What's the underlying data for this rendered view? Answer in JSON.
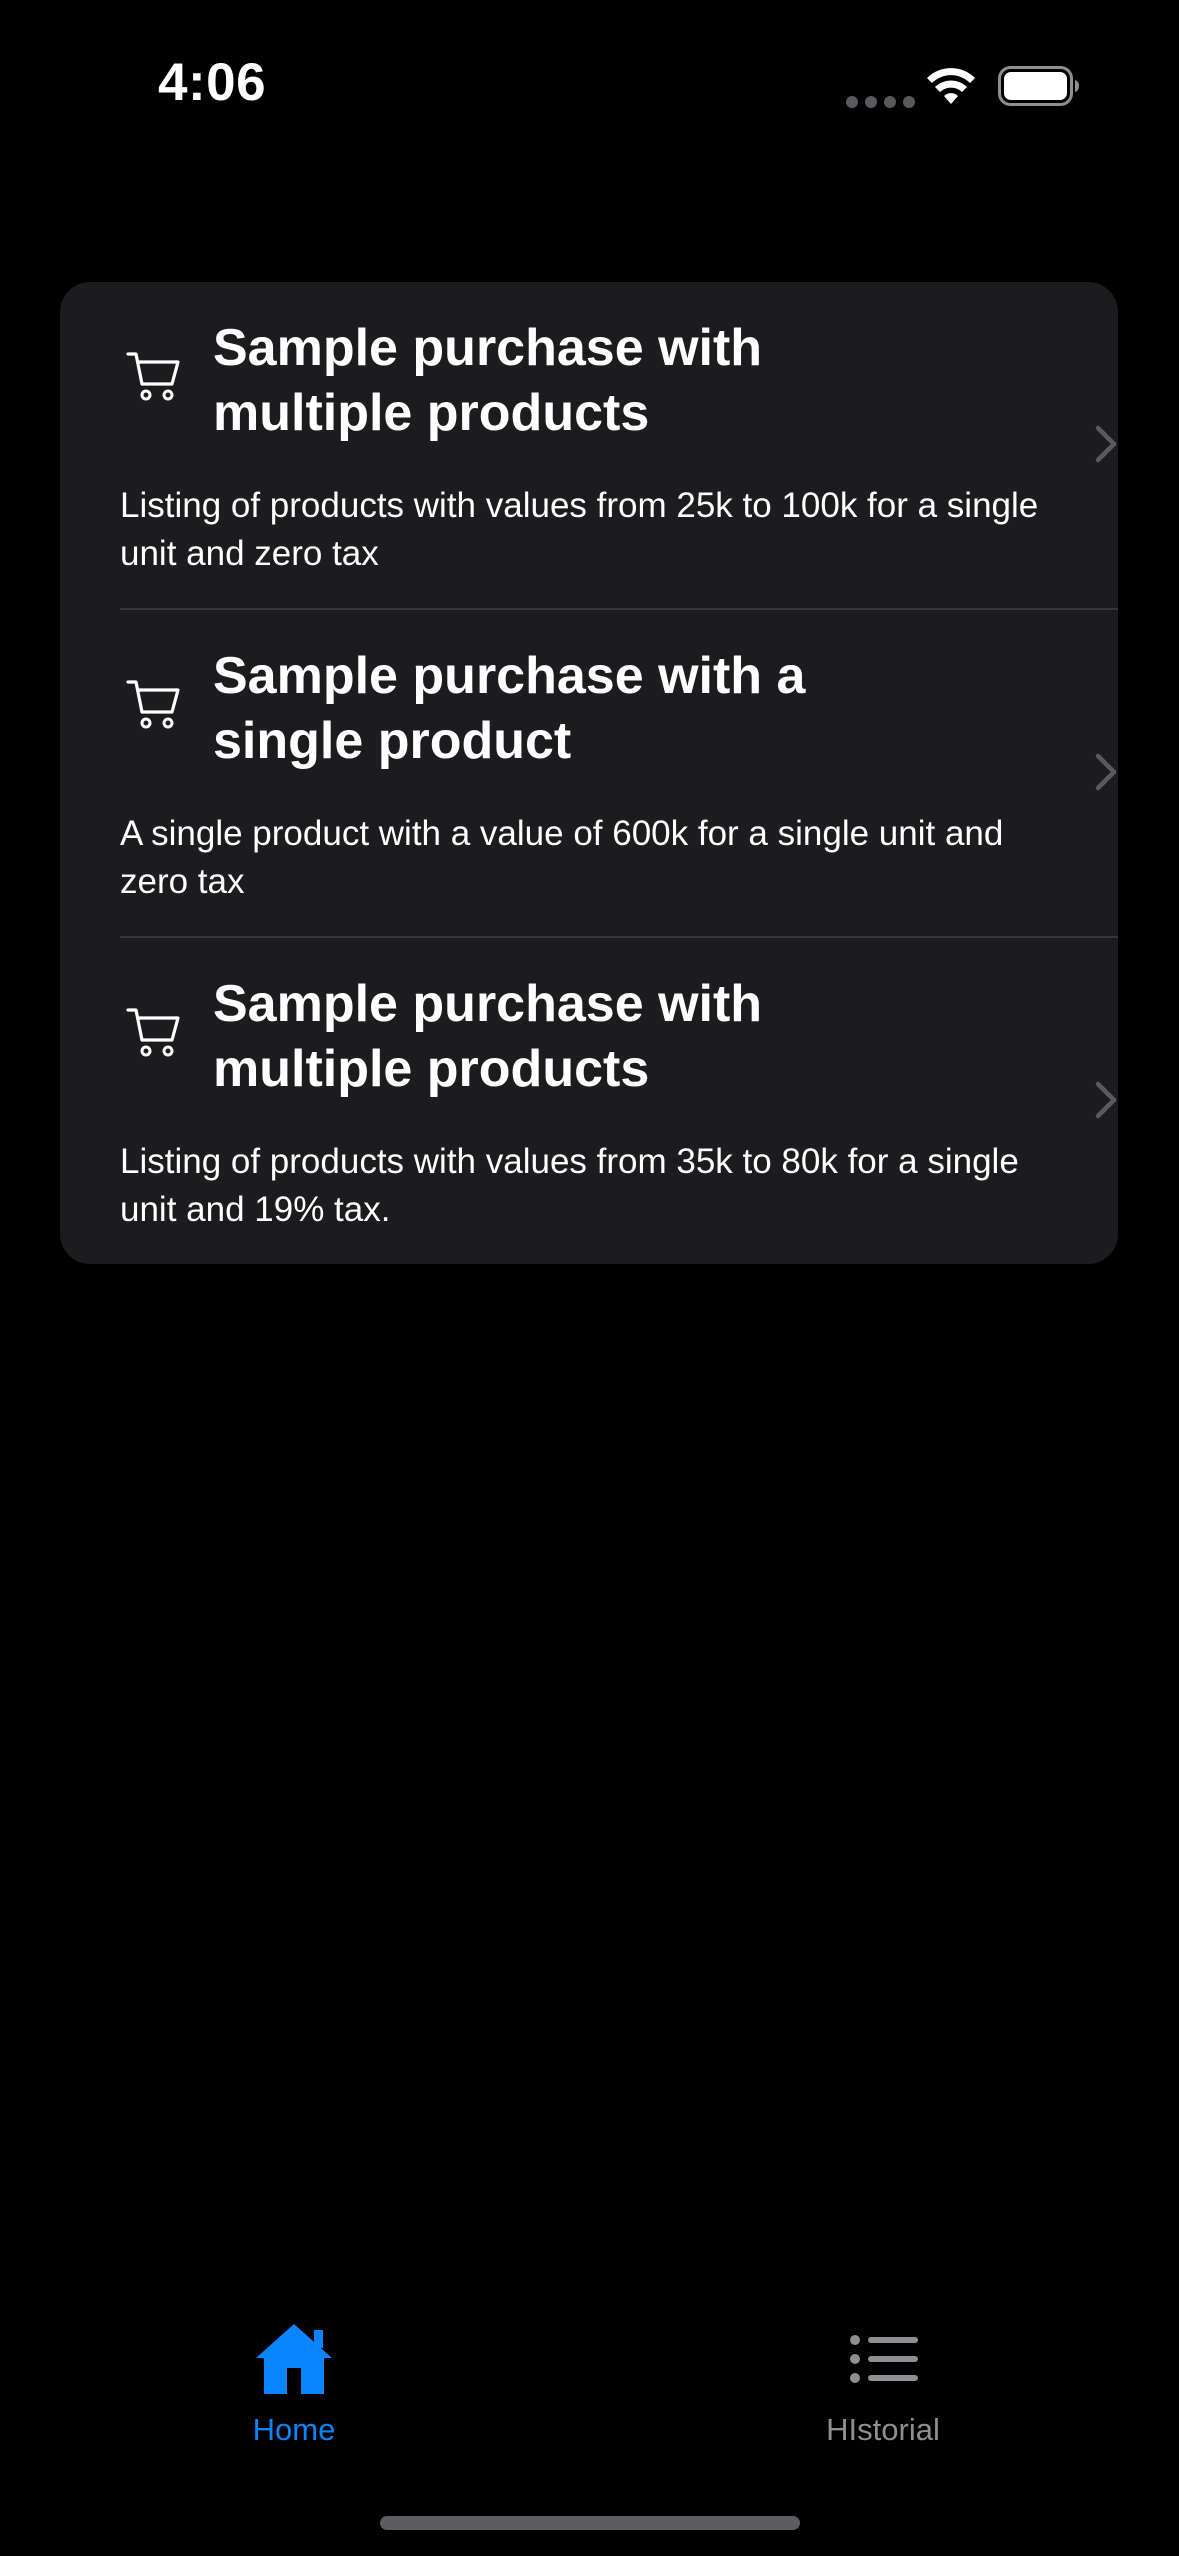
{
  "status_bar": {
    "time": "4:06"
  },
  "purchases": [
    {
      "icon": "cart-icon",
      "title": "Sample purchase with multiple products",
      "description": "Listing of products with values from 25k to 100k for a single unit and zero tax"
    },
    {
      "icon": "cart-icon",
      "title": "Sample purchase with a single product",
      "description": "A single product with a value of 600k for a single unit and zero tax"
    },
    {
      "icon": "cart-icon",
      "title": "Sample purchase with multiple products",
      "description": "Listing of products with values from 35k to 80k for a single unit and 19% tax."
    }
  ],
  "tab_bar": {
    "home": {
      "label": "Home",
      "icon": "house-icon",
      "active": true
    },
    "historial": {
      "label": "HIstorial",
      "icon": "list-icon",
      "active": false
    }
  },
  "colors": {
    "background": "#000000",
    "card": "#1c1c1e",
    "accent": "#0a84ff",
    "inactive": "#8e8e93",
    "chevron": "#5a5a5e"
  }
}
